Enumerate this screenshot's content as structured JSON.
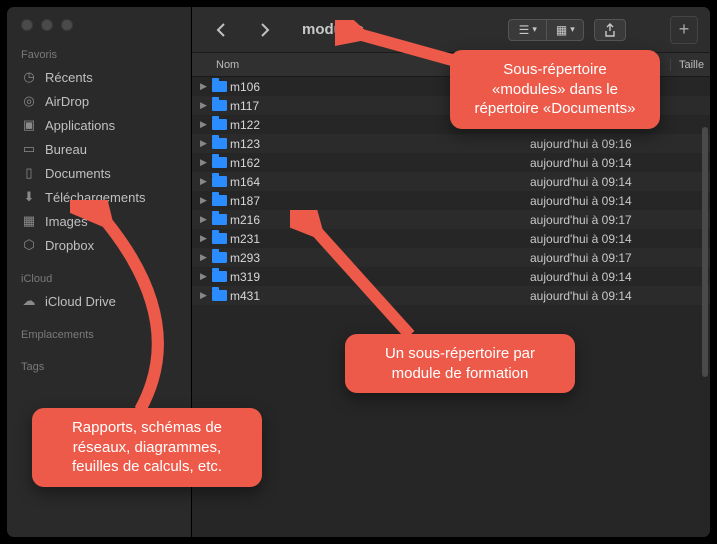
{
  "sidebar": {
    "sections": {
      "favoris": {
        "title": "Favoris",
        "items": [
          {
            "icon": "clock",
            "label": "Récents"
          },
          {
            "icon": "airdrop",
            "label": "AirDrop"
          },
          {
            "icon": "app",
            "label": "Applications"
          },
          {
            "icon": "desktop",
            "label": "Bureau"
          },
          {
            "icon": "doc",
            "label": "Documents"
          },
          {
            "icon": "down",
            "label": "Téléchargements"
          },
          {
            "icon": "image",
            "label": "Images"
          },
          {
            "icon": "dropbox",
            "label": "Dropbox"
          }
        ]
      },
      "icloud": {
        "title": "iCloud",
        "items": [
          {
            "icon": "cloud",
            "label": "iCloud Drive"
          }
        ]
      },
      "emplacements": {
        "title": "Emplacements"
      },
      "tags": {
        "title": "Tags"
      }
    }
  },
  "toolbar": {
    "title": "modules"
  },
  "columns": {
    "name": "Nom",
    "size": "Taille"
  },
  "rows": [
    {
      "name": "m106",
      "date": ""
    },
    {
      "name": "m117",
      "date": ""
    },
    {
      "name": "m122",
      "date": ""
    },
    {
      "name": "m123",
      "date": "aujourd'hui à 09:16"
    },
    {
      "name": "m162",
      "date": "aujourd'hui à 09:14"
    },
    {
      "name": "m164",
      "date": "aujourd'hui à 09:14"
    },
    {
      "name": "m187",
      "date": "aujourd'hui à 09:14"
    },
    {
      "name": "m216",
      "date": "aujourd'hui à 09:17"
    },
    {
      "name": "m231",
      "date": "aujourd'hui à 09:14"
    },
    {
      "name": "m293",
      "date": "aujourd'hui à 09:17"
    },
    {
      "name": "m319",
      "date": "aujourd'hui à 09:14"
    },
    {
      "name": "m431",
      "date": "aujourd'hui à 09:14"
    }
  ],
  "callouts": {
    "top": "Sous-répertoire «modules» dans le répertoire «Documents»",
    "middle": "Un sous-répertoire par module de formation",
    "bottom": "Rapports, schémas de réseaux, diagrammes, feuilles de calculs, etc."
  },
  "icons": {
    "clock": "◷",
    "airdrop": "◎",
    "app": "▣",
    "desktop": "▭",
    "doc": "▯",
    "down": "⬇",
    "image": "▦",
    "dropbox": "⬡",
    "cloud": "☁"
  }
}
